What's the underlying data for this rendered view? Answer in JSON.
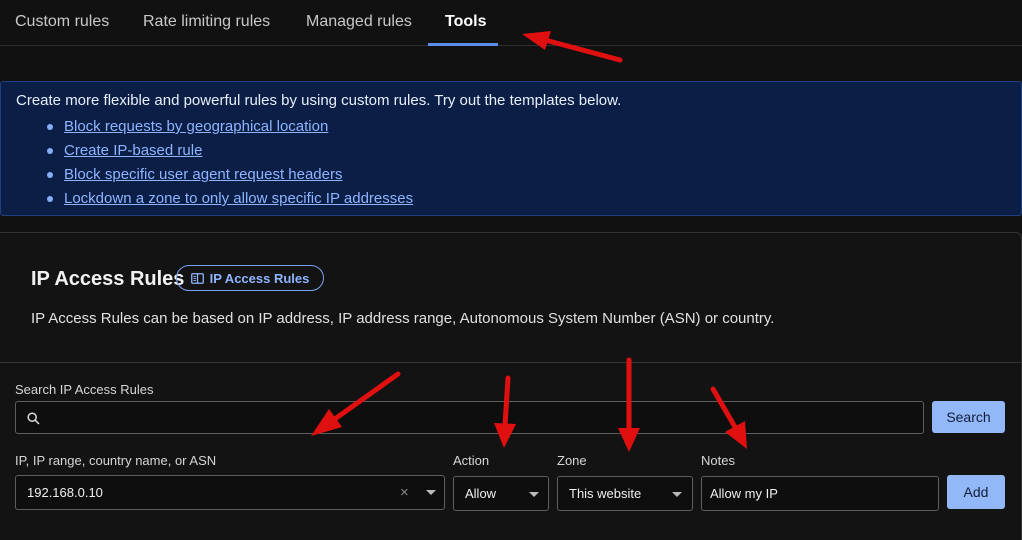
{
  "tabs": [
    {
      "label": "Custom rules"
    },
    {
      "label": "Rate limiting rules"
    },
    {
      "label": "Managed rules"
    },
    {
      "label": "Tools"
    }
  ],
  "info": {
    "text": "Create more flexible and powerful rules by using custom rules. Try out the templates below.",
    "links": [
      "Block requests by geographical location",
      "Create IP-based rule",
      "Block specific user agent request headers",
      "Lockdown a zone to only allow specific IP addresses"
    ]
  },
  "ip_access": {
    "title": "IP Access Rules",
    "doc_badge": "IP Access Rules",
    "description": "IP Access Rules can be based on IP address, IP address range, Autonomous System Number (ASN) or country."
  },
  "search": {
    "label": "Search IP Access Rules",
    "value": "",
    "button": "Search"
  },
  "form": {
    "ip_label": "IP, IP range, country name, or ASN",
    "ip_value": "192.168.0.10",
    "action_label": "Action",
    "action_value": "Allow",
    "zone_label": "Zone",
    "zone_value": "This website",
    "notes_label": "Notes",
    "notes_value": "Allow my IP",
    "add_button": "Add"
  },
  "colors": {
    "accent": "#5a8ee8",
    "button_bg": "#93b8f7",
    "info_bg": "#0b1e46",
    "annotation_arrow": "#e01010"
  }
}
